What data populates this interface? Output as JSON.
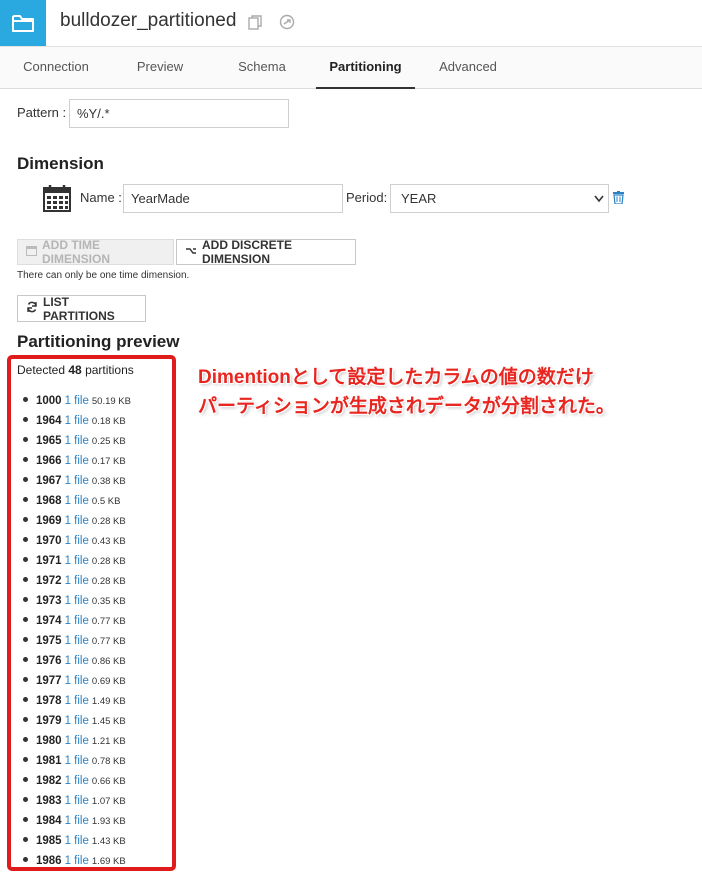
{
  "header": {
    "title": "bulldozer_partitioned",
    "icons": [
      "folder-icon",
      "copy-icon",
      "share-icon"
    ]
  },
  "tabs": [
    {
      "label": "Connection",
      "active": false
    },
    {
      "label": "Preview",
      "active": false
    },
    {
      "label": "Schema",
      "active": false
    },
    {
      "label": "Partitioning",
      "active": true
    },
    {
      "label": "Advanced",
      "active": false
    }
  ],
  "pattern": {
    "label": "Pattern :",
    "value": "%Y/.*"
  },
  "dimension": {
    "title": "Dimension",
    "name_label": "Name :",
    "name_value": "YearMade",
    "period_label": "Period:",
    "period_value": "YEAR"
  },
  "buttons": {
    "add_time": "ADD TIME DIMENSION",
    "add_discrete": "ADD DISCRETE DIMENSION",
    "note": "There can only be one time dimension.",
    "list_partitions": "LIST PARTITIONS"
  },
  "preview": {
    "title": "Partitioning preview",
    "detected_prefix": "Detected ",
    "detected_count": "48",
    "detected_suffix": " partitions",
    "partitions": [
      {
        "year": "1000",
        "files": "1 file",
        "size": "50.19 KB"
      },
      {
        "year": "1964",
        "files": "1 file",
        "size": "0.18 KB"
      },
      {
        "year": "1965",
        "files": "1 file",
        "size": "0.25 KB"
      },
      {
        "year": "1966",
        "files": "1 file",
        "size": "0.17 KB"
      },
      {
        "year": "1967",
        "files": "1 file",
        "size": "0.38 KB"
      },
      {
        "year": "1968",
        "files": "1 file",
        "size": "0.5 KB"
      },
      {
        "year": "1969",
        "files": "1 file",
        "size": "0.28 KB"
      },
      {
        "year": "1970",
        "files": "1 file",
        "size": "0.43 KB"
      },
      {
        "year": "1971",
        "files": "1 file",
        "size": "0.28 KB"
      },
      {
        "year": "1972",
        "files": "1 file",
        "size": "0.28 KB"
      },
      {
        "year": "1973",
        "files": "1 file",
        "size": "0.35 KB"
      },
      {
        "year": "1974",
        "files": "1 file",
        "size": "0.77 KB"
      },
      {
        "year": "1975",
        "files": "1 file",
        "size": "0.77 KB"
      },
      {
        "year": "1976",
        "files": "1 file",
        "size": "0.86 KB"
      },
      {
        "year": "1977",
        "files": "1 file",
        "size": "0.69 KB"
      },
      {
        "year": "1978",
        "files": "1 file",
        "size": "1.49 KB"
      },
      {
        "year": "1979",
        "files": "1 file",
        "size": "1.45 KB"
      },
      {
        "year": "1980",
        "files": "1 file",
        "size": "1.21 KB"
      },
      {
        "year": "1981",
        "files": "1 file",
        "size": "0.78 KB"
      },
      {
        "year": "1982",
        "files": "1 file",
        "size": "0.66 KB"
      },
      {
        "year": "1983",
        "files": "1 file",
        "size": "1.07 KB"
      },
      {
        "year": "1984",
        "files": "1 file",
        "size": "1.93 KB"
      },
      {
        "year": "1985",
        "files": "1 file",
        "size": "1.43 KB"
      },
      {
        "year": "1986",
        "files": "1 file",
        "size": "1.69 KB"
      }
    ]
  },
  "annotation": {
    "line1": "Dimentionとして設定したカラムの値の数だけ",
    "line2": "パーティションが生成されデータが分割された。",
    "color": "#e8251f"
  },
  "colors": {
    "accent": "#2aa9e0",
    "link": "#2a82c5",
    "highlight": "#e01b1b"
  }
}
